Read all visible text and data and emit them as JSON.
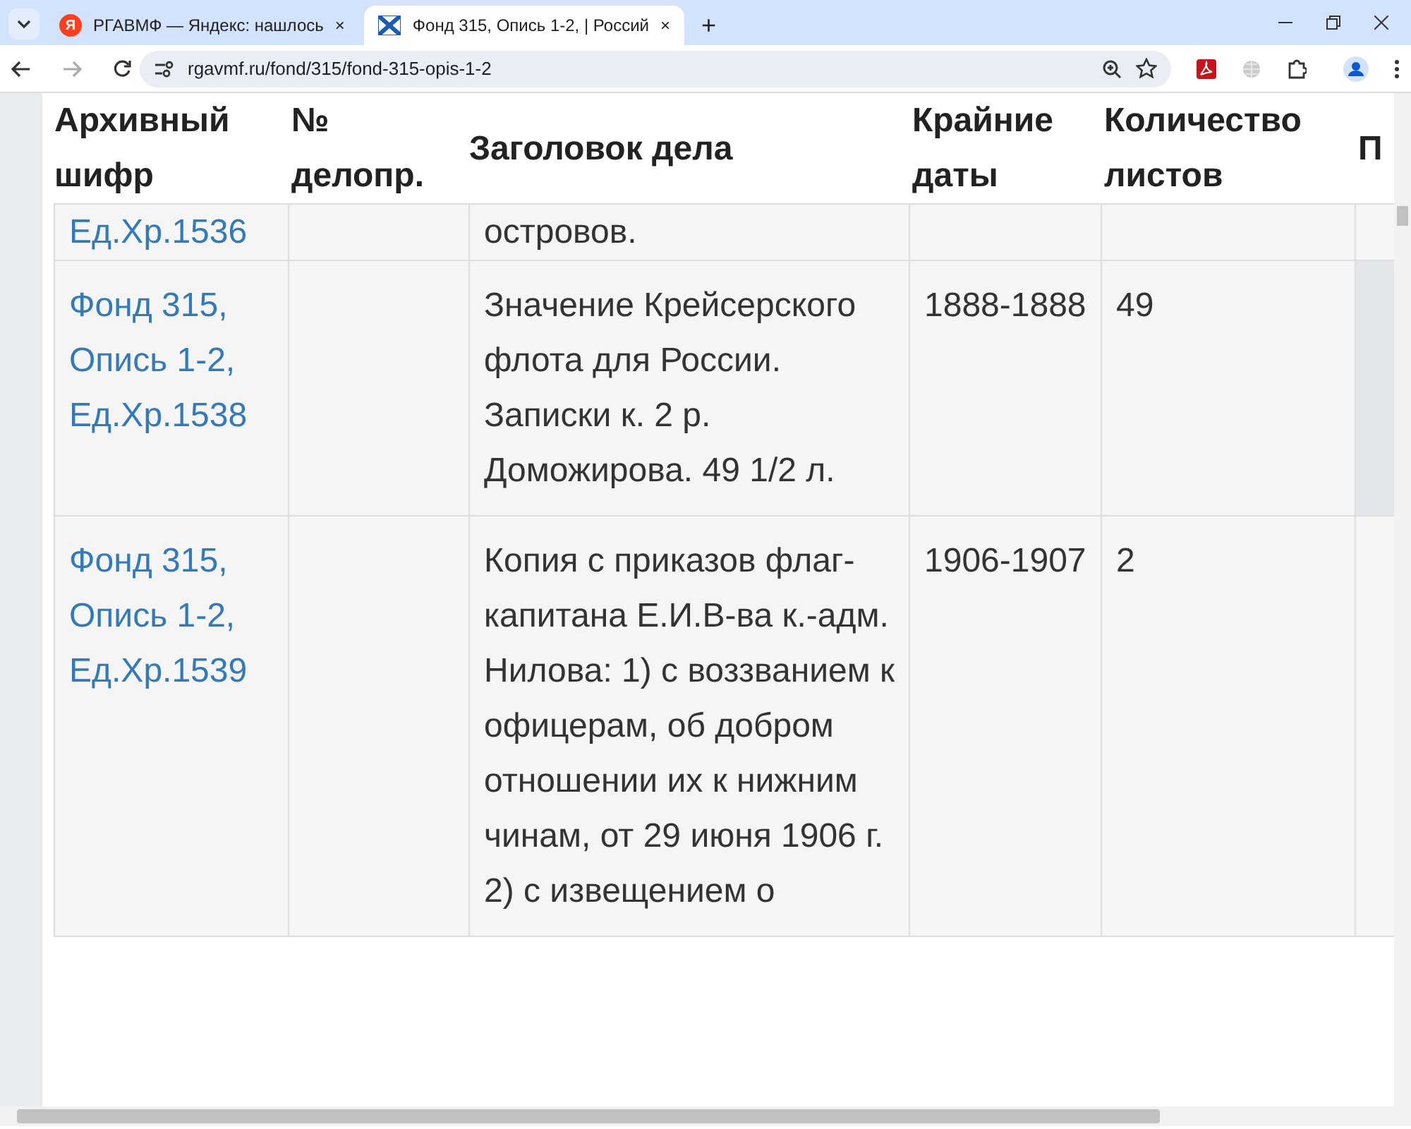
{
  "browser": {
    "tabs": [
      {
        "title": "РГАВМФ — Яндекс: нашлось",
        "selected": false,
        "favicon_text": "Я",
        "close": "×"
      },
      {
        "title": "Фонд 315, Опись 1-2, | Россий",
        "selected": true,
        "close": "×"
      }
    ],
    "new_tab": "+",
    "address": "rgavmf.ru/fond/315/fond-315-opis-1-2"
  },
  "table": {
    "columns": [
      "Архивный шифр",
      "№ делопр.",
      "Заголовок дела",
      "Крайние даты",
      "Количество листов",
      "П"
    ],
    "rows": [
      {
        "highlighted": false,
        "cipher": "Ед.Хр.1536",
        "title": "островов."
      },
      {
        "highlighted": true,
        "cipher": "Фонд 315, Опись 1-2, Ед.Хр.1538",
        "title": "Значение Крейсерского флота для России. Записки к. 2 р. Доможирова. 49 1/2 л.",
        "dates": "1888-1888",
        "sheets": "49"
      },
      {
        "highlighted": false,
        "cipher": "Фонд 315, Опись 1-2, Ед.Хр.1539",
        "title": "Копия с приказов флаг-капитана Е.И.В-ва к.-адм. Нилова: 1) с воззванием к офицерам, об добром отношении их к нижним чинам, от 29 июня 1906 г. 2) с извещением о",
        "dates": "1906-1907",
        "sheets": "2"
      }
    ]
  }
}
